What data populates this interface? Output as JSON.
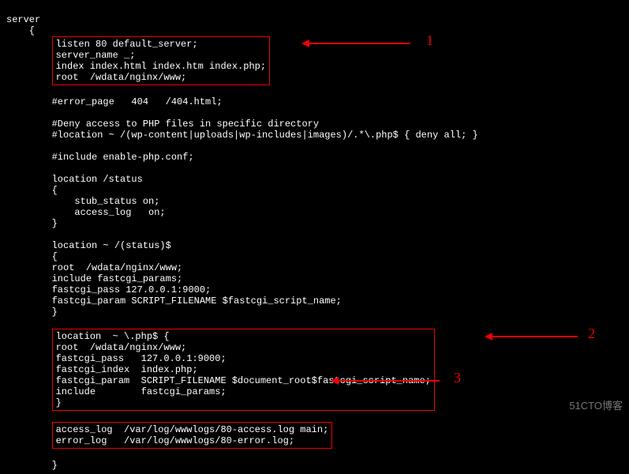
{
  "code": {
    "l1": "server",
    "l2": "    {",
    "box1_l1": "listen 80 default_server;",
    "box1_l2": "server_name _;",
    "box1_l3": "index index.html index.htm index.php;",
    "box1_l4": "root  /wdata/nginx/www;",
    "l7": "",
    "l8": "        #error_page   404   /404.html;",
    "l9": "",
    "l10": "        #Deny access to PHP files in specific directory",
    "l11": "        #location ~ /(wp-content|uploads|wp-includes|images)/.*\\.php$ { deny all; }",
    "l12": "",
    "l13": "        #include enable-php.conf;",
    "l14": "",
    "l15": "        location /status",
    "l16": "        {",
    "l17": "            stub_status on;",
    "l18": "            access_log   on;",
    "l19": "        }",
    "l20": "",
    "l21": "        location ~ /(status)$",
    "l22": "        {",
    "l23": "        root  /wdata/nginx/www;",
    "l24": "        include fastcgi_params;",
    "l25": "        fastcgi_pass 127.0.0.1:9000;",
    "l26": "        fastcgi_param SCRIPT_FILENAME $fastcgi_script_name;",
    "l27": "        }",
    "l28": "",
    "box2_l1": "location  ~ \\.php$ {",
    "box2_l2": "root  /wdata/nginx/www;",
    "box2_l3": "fastcgi_pass   127.0.0.1:9000;",
    "box2_l4": "fastcgi_index  index.php;",
    "box2_l5": "fastcgi_param  SCRIPT_FILENAME $document_root$fastcgi_script_name;",
    "box2_l6": "include        fastcgi_params;",
    "box2_l7": "}",
    "l36": "",
    "box3_l1": "access_log  /var/log/wwwlogs/80-access.log main;",
    "box3_l2": "error_log   /var/log/wwwlogs/80-error.log;",
    "l39": "",
    "l40": "        }"
  },
  "annotations": {
    "a1": "1",
    "a2": "2",
    "a3": "3"
  },
  "watermark": "51CTO博客"
}
